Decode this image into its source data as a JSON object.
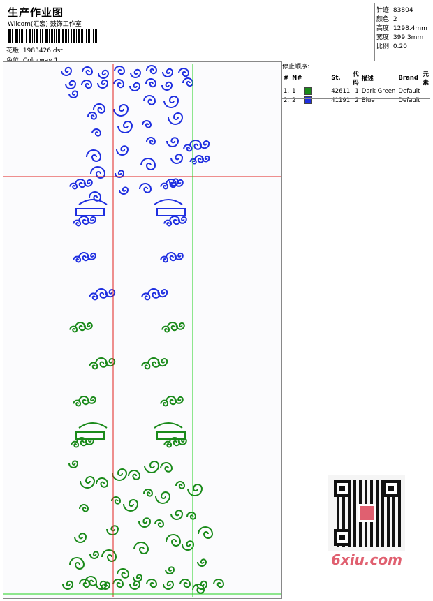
{
  "header": {
    "title": "生产作业图",
    "company": "Wilcom(汇宏) 鼓饰工作室",
    "design_label": "花版:",
    "design_value": "1983426.dst",
    "colorway_label": "色位:",
    "colorway_value": "Colorway 1"
  },
  "stats": [
    {
      "label": "针迹:",
      "value": "83804"
    },
    {
      "label": "颜色:",
      "value": "2"
    },
    {
      "label": "高度:",
      "value": "1298.4mm"
    },
    {
      "label": "宽度:",
      "value": "399.3mm"
    },
    {
      "label": "比例:",
      "value": "0.20"
    }
  ],
  "stop_sequence": {
    "title": "停止顺序:",
    "columns": [
      "#",
      "N#",
      "St.",
      "代码",
      "描述",
      "Brand",
      "元素"
    ],
    "rows": [
      {
        "index": "1.",
        "n": "1",
        "st": "42611",
        "code": "1",
        "desc": "Dark Green",
        "brand": "Default",
        "color": "#1a8a1a"
      },
      {
        "index": "2.",
        "n": "2",
        "st": "41191",
        "code": "2",
        "desc": "Blue",
        "brand": "Default",
        "color": "#1f2fe0"
      }
    ]
  },
  "colors": {
    "blue": "#1f2fe0",
    "green": "#1a8a1a",
    "guide_red": "#e02020",
    "guide_green": "#20d020"
  },
  "watermark": "6xiu.com"
}
